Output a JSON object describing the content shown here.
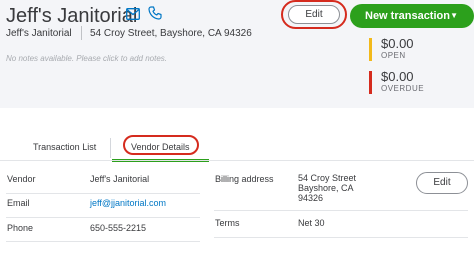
{
  "vendor": {
    "name": "Jeff's Janitorial",
    "address": "54 Croy Street, Bayshore, CA 94326",
    "notes_placeholder": "No notes available. Please click to add notes."
  },
  "actions": {
    "edit_label": "Edit",
    "new_transaction_label": "New transaction",
    "new_transaction_caret": "▼"
  },
  "balances": [
    {
      "amount": "$0.00",
      "label": "OPEN",
      "color": "#f2b91b"
    },
    {
      "amount": "$0.00",
      "label": "OVERDUE",
      "color": "#d52b1e"
    }
  ],
  "tabs": {
    "transaction_list": "Transaction List",
    "vendor_details": "Vendor Details"
  },
  "details": {
    "edit_label": "Edit",
    "vendor_label": "Vendor",
    "vendor_value": "Jeff's Janitorial",
    "email_label": "Email",
    "email_value": "jeff@jjanitorial.com",
    "phone_label": "Phone",
    "phone_value": "650-555-2215",
    "billing_label": "Billing address",
    "billing_lines": [
      "54 Croy Street",
      "Bayshore, CA",
      "94326"
    ],
    "terms_label": "Terms",
    "terms_value": "Net 30"
  },
  "colors": {
    "accent_green": "#2ca01c",
    "highlight_red": "#d52b1e",
    "link_blue": "#0077c5"
  },
  "icons": [
    "mail-icon",
    "phone-icon"
  ]
}
